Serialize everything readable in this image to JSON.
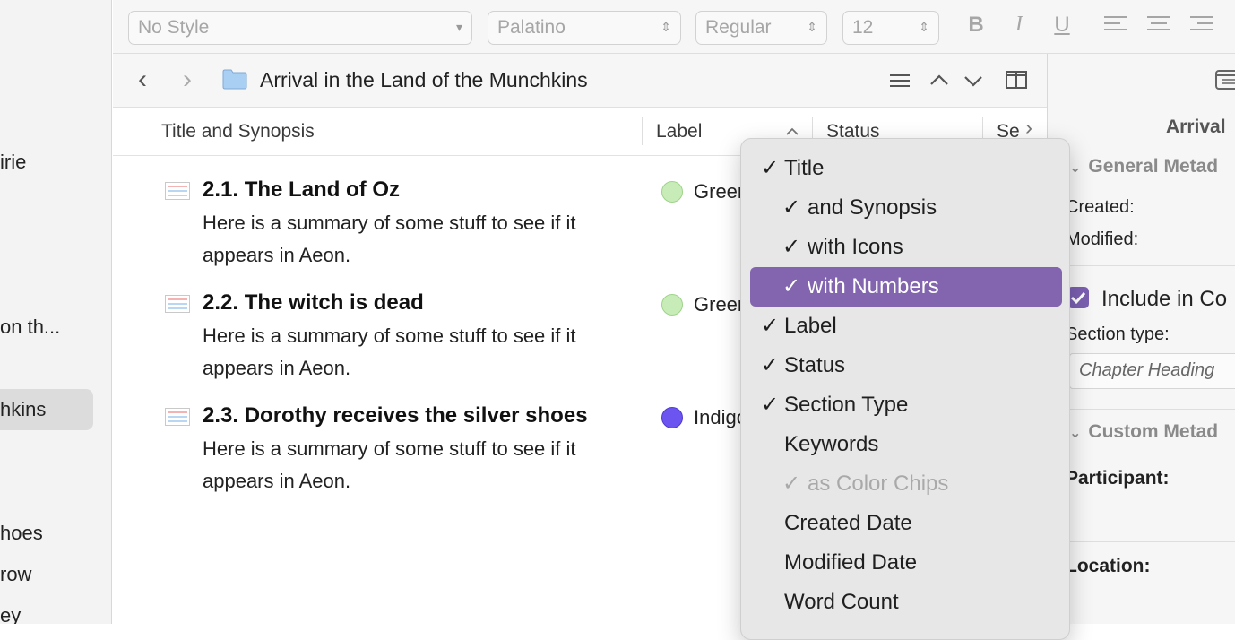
{
  "binder": {
    "items": [
      {
        "label": "irie"
      },
      {
        "label": "on th..."
      },
      {
        "label": "hkins"
      },
      {
        "label": "hoes"
      },
      {
        "label": "row"
      },
      {
        "label": "ey"
      }
    ]
  },
  "formatbar": {
    "style": "No Style",
    "font": "Palatino",
    "weight": "Regular",
    "size": "12",
    "bold": "B",
    "italic": "I",
    "underline": "U"
  },
  "header": {
    "back": "‹",
    "forward": "›",
    "title": "Arrival in the Land of the Munchkins"
  },
  "columns": {
    "title": "Title and Synopsis",
    "label": "Label",
    "status": "Status",
    "section": "Se",
    "more": "›"
  },
  "rows": [
    {
      "title": "2.1. The Land of Oz",
      "synopsis": "Here is a summary of some stuff to see if it appears in Aeon.",
      "label": "Green",
      "label_color": "#c8ecb8"
    },
    {
      "title": "2.2. The witch is dead",
      "synopsis": "Here is a summary of some stuff to see if it appears in Aeon.",
      "label": "Green",
      "label_color": "#c8ecb8"
    },
    {
      "title": "2.3. Dorothy receives the silver shoes",
      "synopsis": "Here is a summary of some stuff to see if it appears in Aeon.",
      "label": "Indigo",
      "label_color": "#6b54f0"
    }
  ],
  "inspector": {
    "title": "Arrival",
    "general_section": "General Metad",
    "created_label": "Created:",
    "modified_label": "Modified:",
    "include_label": "Include in Co",
    "include_checked": true,
    "section_type_label": "Section type:",
    "section_type_value": "Chapter Heading",
    "custom_section": "Custom Metad",
    "participant_label": "Participant:",
    "location_label": "Location:"
  },
  "menu": {
    "items": [
      {
        "label": "Title",
        "checked": true,
        "sub": false,
        "state": "normal"
      },
      {
        "label": "and Synopsis",
        "checked": true,
        "sub": true,
        "state": "normal"
      },
      {
        "label": "with Icons",
        "checked": true,
        "sub": true,
        "state": "normal"
      },
      {
        "label": "with Numbers",
        "checked": true,
        "sub": true,
        "state": "highlighted"
      },
      {
        "label": "Label",
        "checked": true,
        "sub": false,
        "state": "normal"
      },
      {
        "label": "Status",
        "checked": true,
        "sub": false,
        "state": "normal"
      },
      {
        "label": "Section Type",
        "checked": true,
        "sub": false,
        "state": "normal"
      },
      {
        "label": "Keywords",
        "checked": false,
        "sub": false,
        "state": "normal"
      },
      {
        "label": "as Color Chips",
        "checked": true,
        "sub": true,
        "state": "disabled"
      },
      {
        "label": "Created Date",
        "checked": false,
        "sub": false,
        "state": "normal"
      },
      {
        "label": "Modified Date",
        "checked": false,
        "sub": false,
        "state": "normal"
      },
      {
        "label": "Word Count",
        "checked": false,
        "sub": false,
        "state": "normal"
      }
    ],
    "check_glyph": "✓",
    "highlight_color": "#8265ae"
  }
}
